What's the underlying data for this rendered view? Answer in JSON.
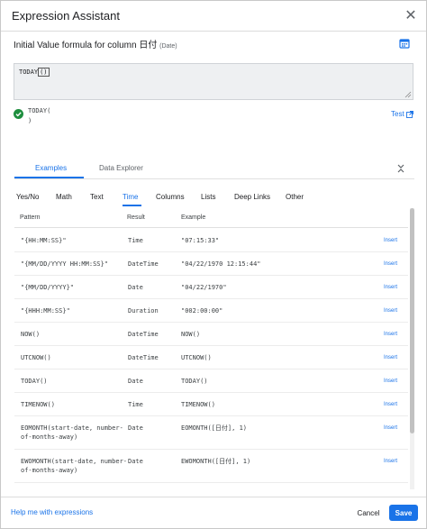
{
  "dialog": {
    "title": "Expression Assistant",
    "close_icon": "close-icon"
  },
  "formula": {
    "label": "Initial Value formula for column",
    "column": "日付",
    "type": "(Date)",
    "expression": "TODAY",
    "expression_cursor": "()",
    "result_line1": "TODAY(",
    "result_line2": ")",
    "test_label": "Test"
  },
  "tabs": [
    {
      "label": "Examples",
      "active": true
    },
    {
      "label": "Data Explorer",
      "active": false
    }
  ],
  "categories": [
    {
      "label": "Yes/No"
    },
    {
      "label": "Math"
    },
    {
      "label": "Text"
    },
    {
      "label": "Time",
      "active": true
    },
    {
      "label": "Columns"
    },
    {
      "label": "Lists"
    },
    {
      "label": "Deep Links"
    },
    {
      "label": "Other"
    }
  ],
  "table": {
    "headers": [
      "Pattern",
      "Result",
      "Example"
    ],
    "insert_label": "Insert",
    "rows": [
      {
        "pattern": "\"{HH:MM:SS}\"",
        "result": "Time",
        "example": "\"07:15:33\""
      },
      {
        "pattern": "\"{MM/DD/YYYY HH:MM:SS}\"",
        "result": "DateTime",
        "example": "\"04/22/1970 12:15:44\""
      },
      {
        "pattern": "\"{MM/DD/YYYY}\"",
        "result": "Date",
        "example": "\"04/22/1970\""
      },
      {
        "pattern": "\"{HHH:MM:SS}\"",
        "result": "Duration",
        "example": "\"002:00:00\""
      },
      {
        "pattern": "NOW()",
        "result": "DateTime",
        "example": "NOW()"
      },
      {
        "pattern": "UTCNOW()",
        "result": "DateTime",
        "example": "UTCNOW()"
      },
      {
        "pattern": "TODAY()",
        "result": "Date",
        "example": "TODAY()"
      },
      {
        "pattern": "TIMENOW()",
        "result": "Time",
        "example": "TIMENOW()"
      },
      {
        "pattern": "EOMONTH(start-date, number-",
        "pattern2": "of-months-away)",
        "result": "Date",
        "example": "EOMONTH([日付], 1)"
      },
      {
        "pattern": "EWOMONTH(start-date, number-",
        "pattern2": "of-months-away)",
        "result": "Date",
        "example": "EWOMONTH([日付], 1)"
      }
    ]
  },
  "footer": {
    "help_label": "Help me with expressions",
    "cancel_label": "Cancel",
    "save_label": "Save"
  },
  "colors": {
    "accent": "#1a73e8",
    "success": "#1e8e3e",
    "editor_bg": "#eef0f2"
  }
}
